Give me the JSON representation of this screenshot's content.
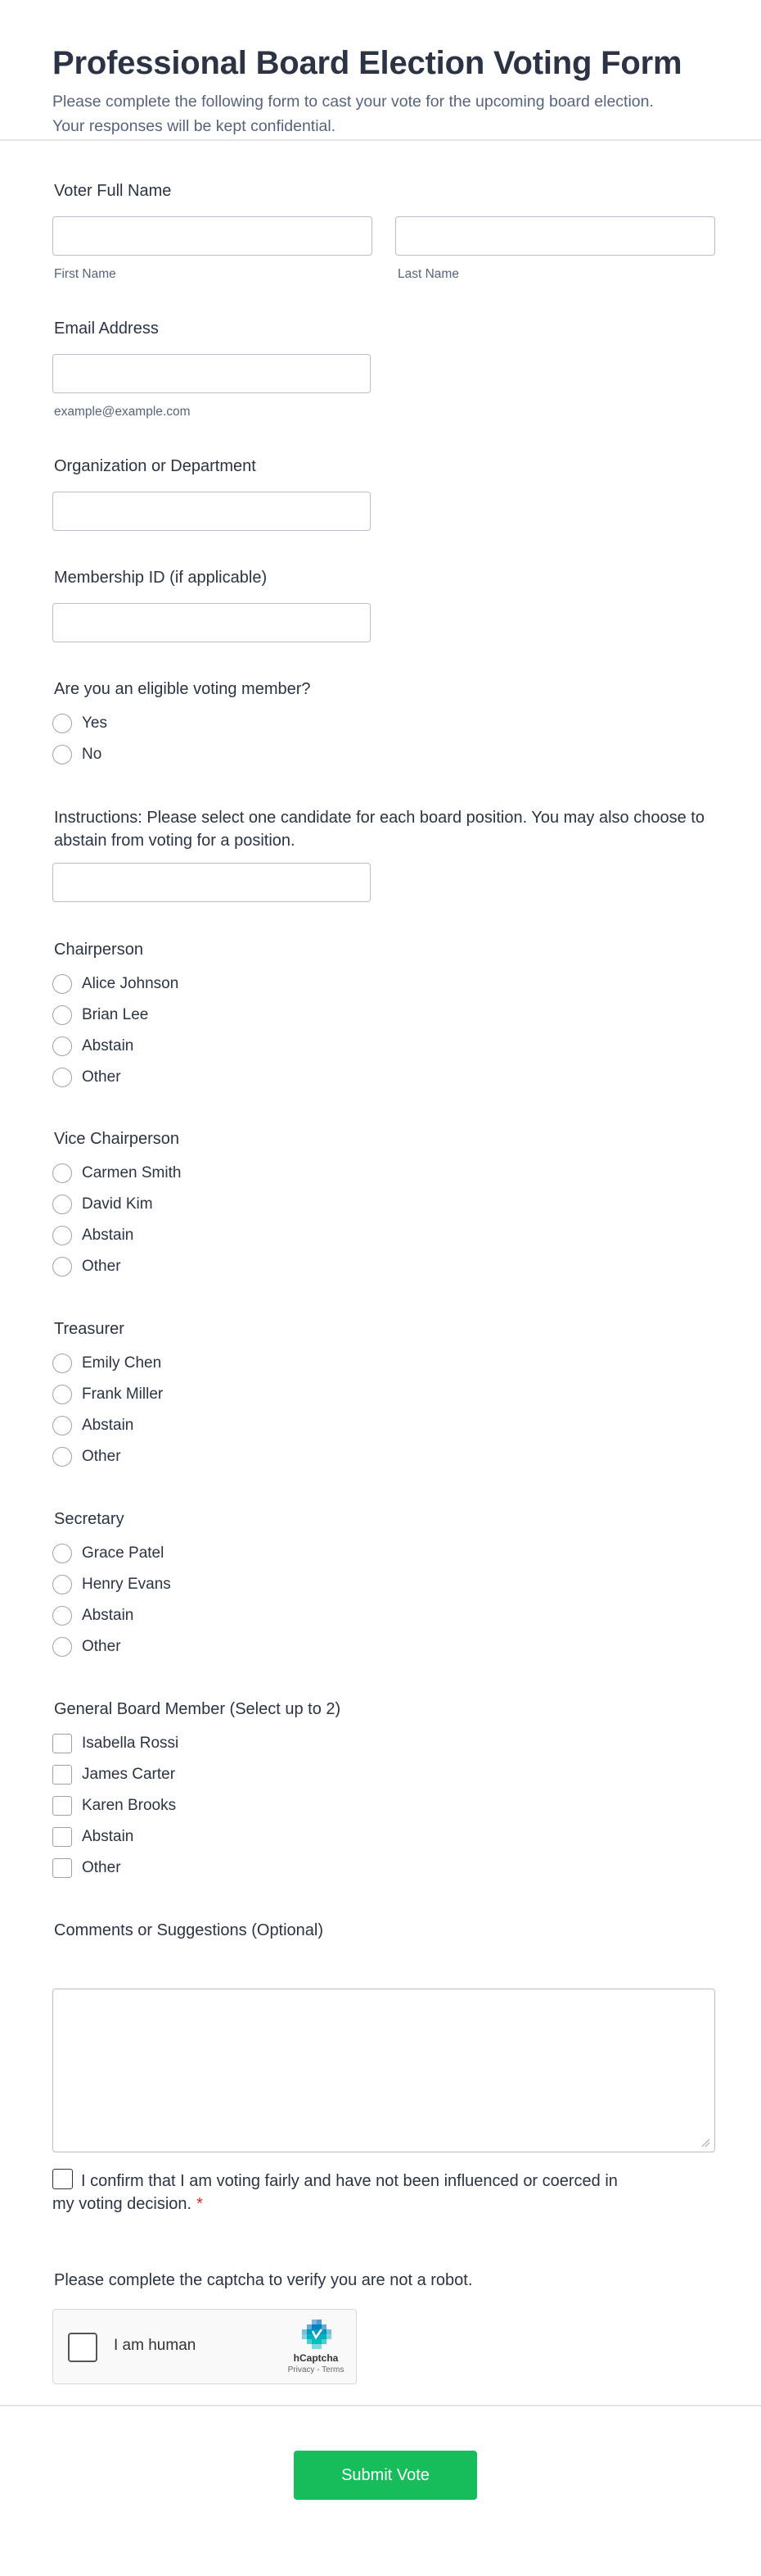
{
  "header": {
    "title": "Professional Board Election Voting Form",
    "subtitle": "Please complete the following form to cast your vote for the upcoming board election. Your responses will be kept confidential."
  },
  "voter_name": {
    "label": "Voter Full Name",
    "first_sublabel": "First Name",
    "last_sublabel": "Last Name",
    "first_value": "",
    "last_value": ""
  },
  "email": {
    "label": "Email Address",
    "sublabel": "example@example.com",
    "value": ""
  },
  "organization": {
    "label": "Organization or Department",
    "value": ""
  },
  "membership": {
    "label": "Membership ID (if applicable)",
    "value": ""
  },
  "eligible": {
    "label": "Are you an eligible voting member?",
    "options": [
      "Yes",
      "No"
    ]
  },
  "instructions": {
    "label": "Instructions: Please select one candidate for each board position. You may also choose to abstain from voting for a position.",
    "value": ""
  },
  "chairperson": {
    "label": "Chairperson",
    "options": [
      "Alice Johnson",
      "Brian Lee",
      "Abstain",
      "Other"
    ]
  },
  "vice_chair": {
    "label": "Vice Chairperson",
    "options": [
      "Carmen Smith",
      "David Kim",
      "Abstain",
      "Other"
    ]
  },
  "treasurer": {
    "label": "Treasurer",
    "options": [
      "Emily Chen",
      "Frank Miller",
      "Abstain",
      "Other"
    ]
  },
  "secretary": {
    "label": "Secretary",
    "options": [
      "Grace Patel",
      "Henry Evans",
      "Abstain",
      "Other"
    ]
  },
  "general": {
    "label": "General Board Member (Select up to 2)",
    "options": [
      "Isabella Rossi",
      "James Carter",
      "Karen Brooks",
      "Abstain",
      "Other"
    ]
  },
  "comments": {
    "label": "Comments or Suggestions (Optional)",
    "value": ""
  },
  "confirm": {
    "text": "I confirm that I am voting fairly and have not been influenced or coerced in my voting decision.",
    "required_mark": "*"
  },
  "captcha": {
    "label": "Please complete the captcha to verify you are not a robot.",
    "checkbox_label": "I am human",
    "brand": "hCaptcha",
    "links": "Privacy - Terms",
    "logo_icon": "hcaptcha-logo-icon"
  },
  "submit": {
    "label": "Submit Vote",
    "color": "#18bd5b"
  }
}
